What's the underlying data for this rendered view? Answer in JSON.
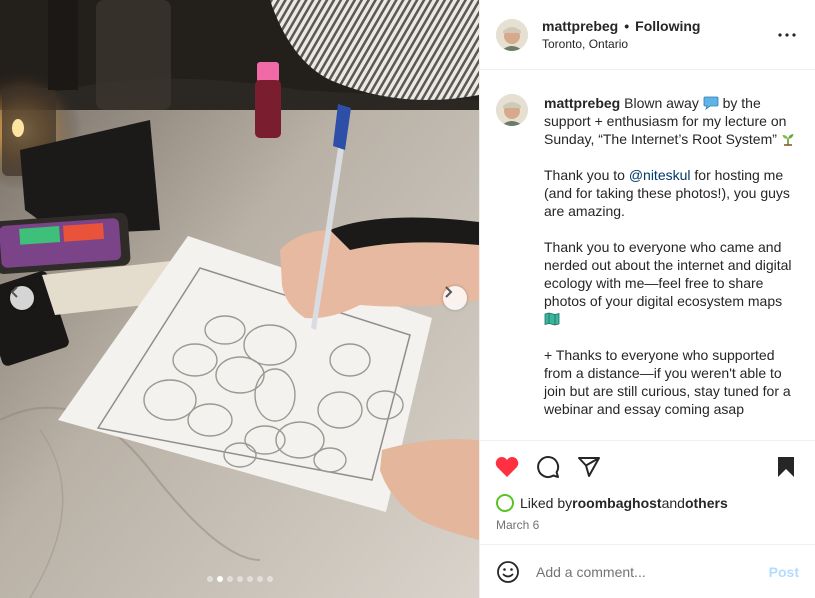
{
  "colors": {
    "like_red": "#ff3040",
    "mention_blue": "#00376b",
    "post_disabled": "#b3dbff",
    "muted": "#737373",
    "story_ring": "#58c322"
  },
  "media": {
    "alt_subject": "",
    "slide_count": 7,
    "active_slide": 2,
    "icons": {
      "prev": "chevron-left-icon",
      "next": "chevron-right-icon"
    }
  },
  "header": {
    "username": "mattprebeg",
    "separator": "•",
    "follow_label": "Following",
    "location": "Toronto, Ontario",
    "more_icon": "ellipsis-icon"
  },
  "caption": {
    "username": "mattprebeg",
    "line1_a": "Blown away ",
    "line1_b": " by the support + enthusiasm for my lecture on Sunday, “The Internet’s Root System” ",
    "p2_a": "Thank you to ",
    "mention": "@niteskul",
    "p2_b": " for hosting me (and for taking these photos!), you guys are amazing.",
    "p3": "Thank you to everyone who came and nerded out about the internet and digital ecology with me—feel free to share photos of your digital ecosystem maps ",
    "p4": "+ Thanks to everyone who supported from a distance—if you weren't able to join but are still curious, stay tuned for a webinar and essay coming asap"
  },
  "actions": {
    "like_icon": "heart-filled-icon",
    "comment_icon": "comment-icon",
    "share_icon": "share-icon",
    "save_icon": "bookmark-filled-icon"
  },
  "likes": {
    "prefix": "Liked by ",
    "user": "roombaghost",
    "middle": " and ",
    "others": "others"
  },
  "date": "March 6",
  "comment_box": {
    "placeholder": "Add a comment...",
    "post_label": "Post",
    "emoji_icon": "smiley-icon"
  }
}
